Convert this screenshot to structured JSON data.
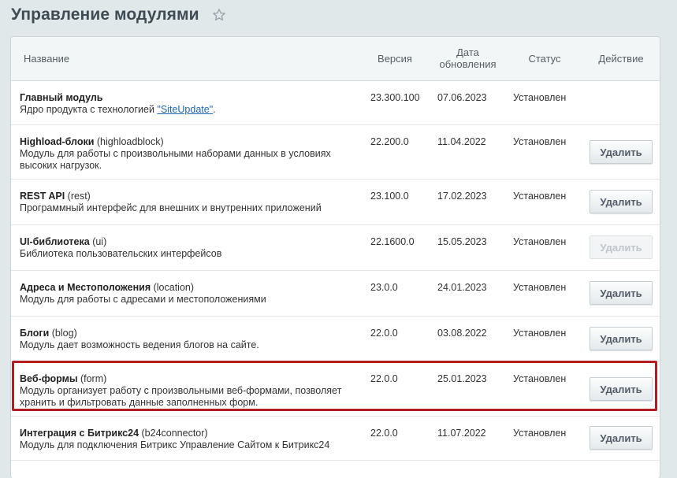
{
  "page": {
    "title": "Управление модулями"
  },
  "table": {
    "headers": {
      "name": "Название",
      "version": "Версия",
      "date_line1": "Дата",
      "date_line2": "обновления",
      "status": "Статус",
      "action": "Действие"
    },
    "rows": [
      {
        "title": "Главный модуль",
        "code": "",
        "desc_before": "Ядро продукта с технологией ",
        "desc_link": "\"SiteUpdate\"",
        "desc_after": ".",
        "version": "23.300.100",
        "date": "07.06.2023",
        "status": "Установлен",
        "action": ""
      },
      {
        "title": "Highload-блоки",
        "code": " (highloadblock)",
        "desc": "Модуль для работы с произвольными наборами данных в условиях высоких нагрузок.",
        "version": "22.200.0",
        "date": "11.04.2022",
        "status": "Установлен",
        "action": "Удалить"
      },
      {
        "title": "REST API",
        "code": " (rest)",
        "desc": "Программный интерфейс для внешних и внутренних приложений",
        "version": "23.100.0",
        "date": "17.02.2023",
        "status": "Установлен",
        "action": "Удалить"
      },
      {
        "title": "UI-библиотека",
        "code": " (ui)",
        "desc": "Библиотека пользовательских интерфейсов",
        "version": "22.1600.0",
        "date": "15.05.2023",
        "status": "Установлен",
        "action": "Удалить"
      },
      {
        "title": "Адреса и Местоположения",
        "code": " (location)",
        "desc": "Модуль для работы с адресами и местоположениями",
        "version": "23.0.0",
        "date": "24.01.2023",
        "status": "Установлен",
        "action": "Удалить"
      },
      {
        "title": "Блоги",
        "code": " (blog)",
        "desc": "Модуль дает возможность ведения блогов на сайте.",
        "version": "22.0.0",
        "date": "03.08.2022",
        "status": "Установлен",
        "action": "Удалить"
      },
      {
        "title": "Веб-формы",
        "code": " (form)",
        "desc": "Модуль организует работу с произвольными веб-формами, позволяет хранить и фильтровать данные заполненных форм.",
        "version": "22.0.0",
        "date": "25.01.2023",
        "status": "Установлен",
        "action": "Удалить"
      },
      {
        "title": "Интеграция с Битрикс24",
        "code": " (b24connector)",
        "desc": "Модуль для подключения Битрикс Управление Сайтом к Битрикс24",
        "version": "22.0.0",
        "date": "11.07.2022",
        "status": "Установлен",
        "action": "Удалить"
      }
    ]
  },
  "colors": {
    "highlight": "#b31c20",
    "link": "#2067b0",
    "background": "#e0e8ea"
  },
  "icons": {
    "favorite": "star-outline-icon"
  }
}
